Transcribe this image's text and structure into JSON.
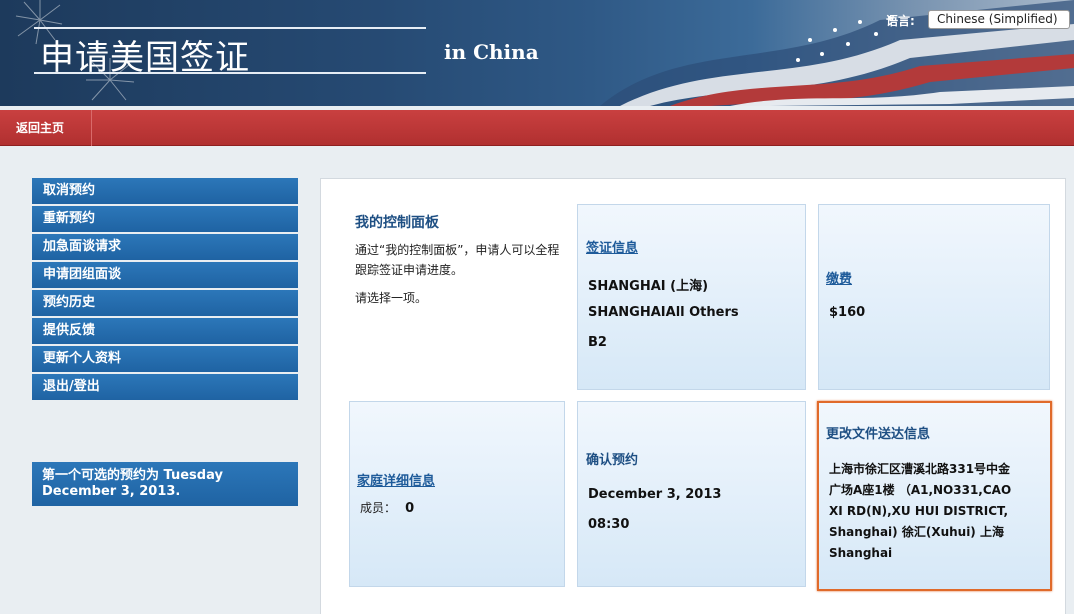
{
  "header": {
    "title": "申请美国签证",
    "subtitle": "in China",
    "language_label": "语言:",
    "language_selected": "Chinese (Simplified)"
  },
  "nav": {
    "home": "返回主页"
  },
  "sidebar": {
    "items": [
      {
        "label": "取消预约"
      },
      {
        "label": "重新预约"
      },
      {
        "label": "加急面谈请求"
      },
      {
        "label": "申请团组面谈"
      },
      {
        "label": "预约历史"
      },
      {
        "label": "提供反馈"
      },
      {
        "label": "更新个人资料"
      },
      {
        "label": "退出/登出"
      }
    ],
    "next_appointment_line1": "第一个可选的预约为 Tuesday",
    "next_appointment_line2": "December 3, 2013."
  },
  "dashboard": {
    "title": "我的控制面板",
    "description": "通过“我的控制面板”，申请人可以全程跟踪签证申请进度。",
    "prompt": "请选择一项。"
  },
  "cards": {
    "visa_info": {
      "link": "签证信息",
      "post": "SHANGHAI (上海)",
      "category": "SHANGHAIAll Others",
      "visa_class": "B2"
    },
    "payment": {
      "link": "缴费",
      "amount": "$160"
    },
    "family": {
      "link": "家庭详细信息",
      "members_label": "成员：",
      "members_count": "0"
    },
    "appointment": {
      "head": "确认预约",
      "date": "December 3, 2013",
      "time": "08:30"
    },
    "delivery": {
      "head": "更改文件送达信息",
      "address_l1": "上海市徐汇区漕溪北路331号中金",
      "address_l2": "广场A座1楼 （A1,NO331,CAO",
      "address_l3": "XI RD(N),XU HUI DISTRICT,",
      "address_l4": "Shanghai) 徐汇(Xuhui) 上海",
      "address_l5": "Shanghai"
    }
  }
}
